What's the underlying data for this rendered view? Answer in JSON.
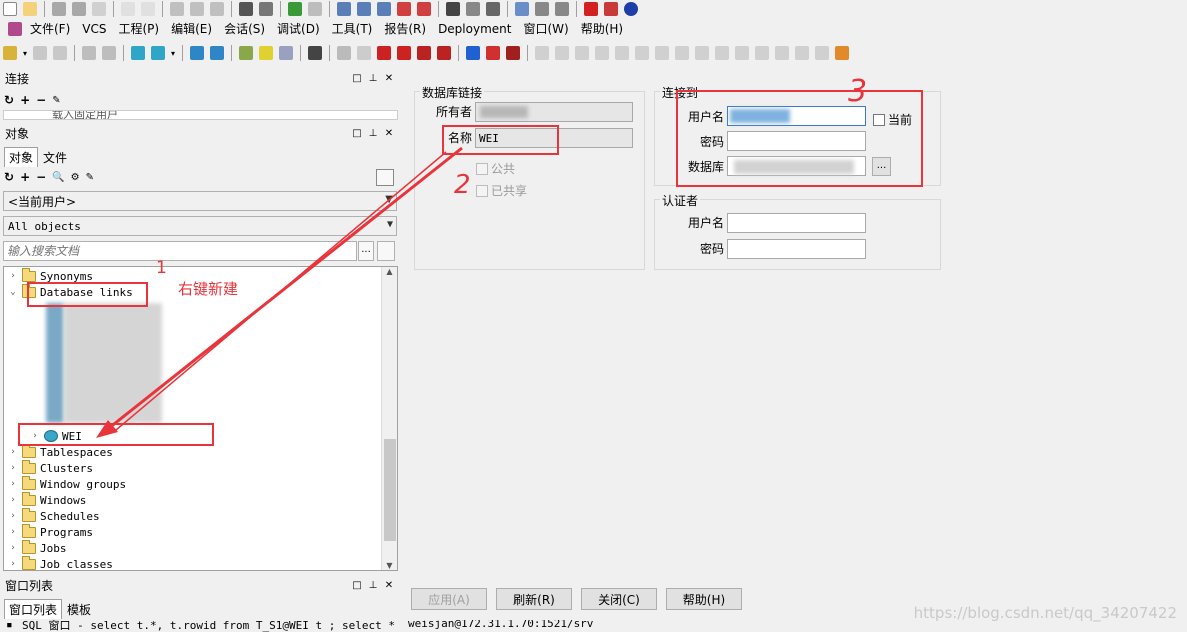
{
  "menu": {
    "items": [
      "文件(F)",
      "VCS",
      "工程(P)",
      "编辑(E)",
      "会话(S)",
      "调试(D)",
      "工具(T)",
      "报告(R)",
      "Deployment",
      "窗口(W)",
      "帮助(H)"
    ]
  },
  "connection_panel": {
    "title": "连接",
    "tree_item": "载入固定用户"
  },
  "objects_panel": {
    "title": "对象",
    "tabs": [
      "对象",
      "文件"
    ],
    "user_combo": "<当前用户>",
    "filter_combo": "All objects",
    "search_placeholder": "输入搜索文档",
    "search_button": "...",
    "tree": {
      "synonyms": "Synonyms",
      "database_links": "Database links",
      "new_link": "WEI",
      "others": [
        "Tablespaces",
        "Clusters",
        "Window groups",
        "Windows",
        "Schedules",
        "Programs",
        "Jobs",
        "Job classes"
      ]
    }
  },
  "window_list_panel": {
    "title": "窗口列表",
    "tabs": [
      "窗口列表",
      "模板"
    ]
  },
  "form": {
    "dblink_group": "数据库链接",
    "owner_label": "所有者",
    "name_label": "名称",
    "name_value": "WEI",
    "public_label": "公共",
    "shared_label": "已共享",
    "connect_group": "连接到",
    "username_label": "用户名",
    "current_label": "当前",
    "password_label": "密码",
    "database_label": "数据库",
    "database_btn": "...",
    "auth_group": "认证者",
    "auth_username_label": "用户名",
    "auth_password_label": "密码"
  },
  "buttons": {
    "apply": "应用(A)",
    "refresh": "刷新(R)",
    "close": "关闭(C)",
    "help": "帮助(H)"
  },
  "annotations": {
    "right_click_new": "右键新建",
    "mark_1": "1",
    "mark_2": "2",
    "mark_3": "3"
  },
  "statusbar": {
    "left": "SQL 窗口 - select t.*, t.rowid from T_S1@WEI t ; select *",
    "right": "weisjan@172.31.1.70:1521/srv"
  },
  "watermark": "https://blog.csdn.net/qq_34207422",
  "colors": {
    "annotation_red": "#e8343a",
    "panel_bg": "#f0f0f0"
  }
}
